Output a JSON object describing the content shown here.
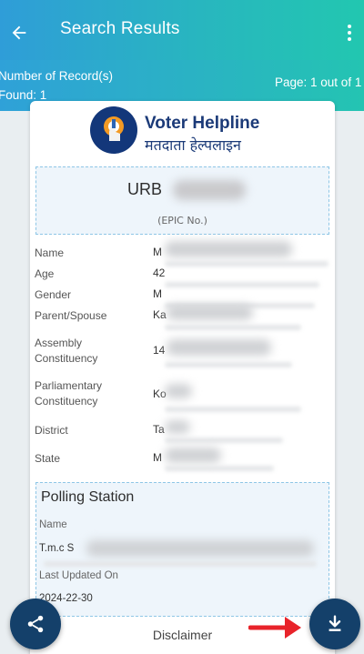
{
  "header": {
    "title": "Search Results",
    "back_icon": "arrow-left-icon",
    "menu_icon": "more-vertical-icon"
  },
  "info": {
    "records_line1": "Number of Record(s)",
    "records_line2": "Found: 1",
    "page": "Page: 1 out of 1"
  },
  "logo": {
    "title_en": "Voter Helpline",
    "title_hi": "मतदाता हेल्पलाइन",
    "badge_text": "Voter"
  },
  "epic": {
    "number_visible": "URB",
    "label": "(EPIC No.)"
  },
  "fields": [
    {
      "label": "Name",
      "value": "M"
    },
    {
      "label": "Age",
      "value": "42"
    },
    {
      "label": "Gender",
      "value": "M"
    },
    {
      "label": "Parent/Spouse",
      "value": "Ka"
    },
    {
      "label": "Assembly Constituency",
      "value": "14"
    },
    {
      "label": "Parliamentary Constituency",
      "value": "Ko"
    },
    {
      "label": "District",
      "value": "Ta"
    },
    {
      "label": "State",
      "value": "M"
    }
  ],
  "polling": {
    "title": "Polling Station",
    "name_label": "Name",
    "name_value": "T.m.c S",
    "updated_label": "Last Updated On",
    "updated_value": "2024-22-30"
  },
  "disclaimer": "Disclaimer",
  "colors": {
    "header_gradient_start": "#2f9dd8",
    "header_gradient_end": "#22c7b0",
    "fab": "#14406a",
    "brand_text": "#1b3a78",
    "annotation_arrow": "#e8232a"
  },
  "fabs": {
    "share_icon": "share-icon",
    "download_icon": "download-icon"
  }
}
